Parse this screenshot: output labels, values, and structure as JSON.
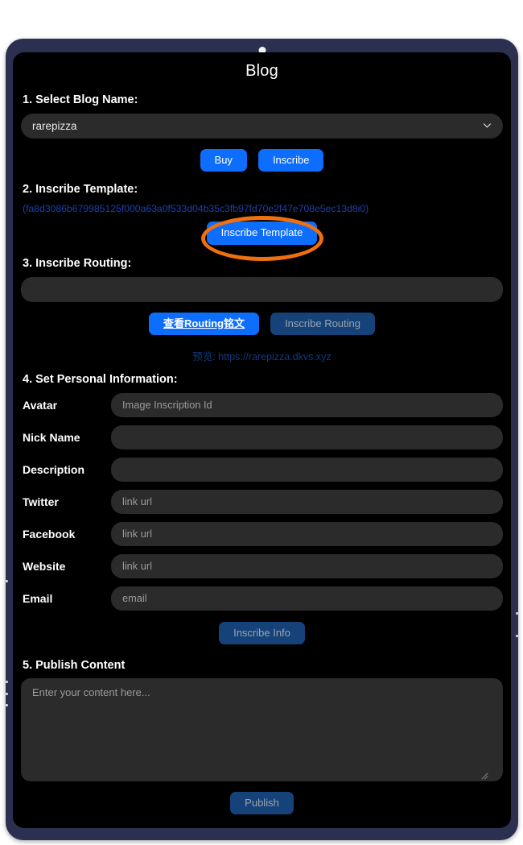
{
  "app": {
    "title": "Blog"
  },
  "colors": {
    "frame": "#2b2f50",
    "screen_bg": "#000000",
    "field_bg": "#2b2b2b",
    "accent_blue": "#0d6efd",
    "disabled_blue": "#16427a",
    "hash_blue": "#1d3fa8",
    "preview_blue": "#13387f",
    "highlight_orange": "#f07010"
  },
  "step1": {
    "label": "1. Select Blog Name:",
    "select_value": "rarepizza",
    "chevron_icon": "chevron-down-icon",
    "buy_label": "Buy",
    "inscribe_label": "Inscribe"
  },
  "step2": {
    "label": "2. Inscribe Template:",
    "hash": "(fa8d3086b679985125f000a63a0f533d04b35c3fb97fd70e2f47e708e5ec13d8i0)",
    "button_label": "Inscribe Template"
  },
  "step3": {
    "label": "3. Inscribe Routing:",
    "input_value": "",
    "input_placeholder": "",
    "view_routing_label": "查看Routing铭文",
    "inscribe_routing_label": "Inscribe Routing",
    "preview_text": "预览: https://rarepizza.dkvs.xyz"
  },
  "step4": {
    "label": "4. Set Personal Information:",
    "fields": [
      {
        "label": "Avatar",
        "placeholder": "Image Inscription Id",
        "value": ""
      },
      {
        "label": "Nick Name",
        "placeholder": "",
        "value": ""
      },
      {
        "label": "Description",
        "placeholder": "",
        "value": ""
      },
      {
        "label": "Twitter",
        "placeholder": "link url",
        "value": ""
      },
      {
        "label": "Facebook",
        "placeholder": "link url",
        "value": ""
      },
      {
        "label": "Website",
        "placeholder": "link url",
        "value": ""
      },
      {
        "label": "Email",
        "placeholder": "email",
        "value": ""
      }
    ],
    "inscribe_info_label": "Inscribe Info"
  },
  "step5": {
    "label": "5. Publish Content",
    "textarea_placeholder": "Enter your content here...",
    "textarea_value": "",
    "publish_label": "Publish"
  }
}
